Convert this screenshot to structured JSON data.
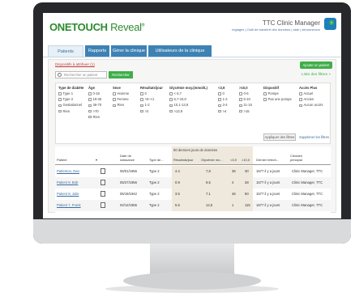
{
  "app": {
    "logo_main": "ONETOUCH",
    "logo_sub": "Reveal",
    "logo_mark": "®",
    "title": "TTC Clinic Manager",
    "header_links": "réglages | Outil de transfert des données | aide | déconnexion",
    "notification_count": "1"
  },
  "tabs": [
    {
      "label": "Patients",
      "active": true
    },
    {
      "label": "Rapports",
      "active": false
    },
    {
      "label": "Gérer la clinique",
      "active": false
    },
    {
      "label": "Utilisateurs de la clinique",
      "active": false
    }
  ],
  "toolbar": {
    "alert": "Dispositifs à attribuer (1)",
    "add_patient": "Ajouter un patient",
    "search_placeholder": "Rechercher un patient",
    "search_button": "Rechercher",
    "filters_link": "Liste des filtres »"
  },
  "filters": {
    "type": {
      "header": "Type de diabète",
      "options": [
        "Type 1",
        "Type 2",
        "Gestationnel",
        "Rien"
      ]
    },
    "age": {
      "header": "Âge",
      "options": [
        "0-18",
        "19-35",
        "36-70",
        ">70",
        "Rien"
      ]
    },
    "sex": {
      "header": "Sexe",
      "options": [
        "Homme",
        "Femme",
        "Rien"
      ]
    },
    "results": {
      "header": "Résultats/jour",
      "options": [
        "0",
        ">0–<1",
        "1-2",
        ">2"
      ]
    },
    "glycemia": {
      "header": "Glycémie moy.(mmol/L)",
      "options": [
        "< 6,7",
        "6,7-10,0",
        "10,1-13,9",
        ">13,9"
      ]
    },
    "lt39": {
      "header": "<3,9",
      "options": [
        "0",
        "1-2",
        "3-4",
        ">4"
      ]
    },
    "gt100": {
      "header": ">10,0",
      "options": [
        "0-5",
        "6-10",
        "11-15",
        ">15"
      ]
    },
    "device": {
      "header": "Dispositif",
      "options": [
        "Pompe",
        "Pas une pompe"
      ]
    },
    "access": {
      "header": "Accès Plus",
      "options": [
        "Actuel",
        "Ancien",
        "Aucun accès"
      ]
    },
    "apply": "Appliquer des filtres",
    "clear": "Supprimer les filtres"
  },
  "table": {
    "band_title": "90 derniers jours de données",
    "headers": {
      "patient": "Patient",
      "birth": "Date de\nnaissance",
      "type": "Type de...",
      "results": "Résultats/jour",
      "glycemia": "Glycémie mo...",
      "lt39": "<3,9",
      "gt100": ">10,0",
      "last_sync": "Dernier télech...",
      "clinician": "Clinicien\nprincipal"
    },
    "rows": [
      {
        "patient": "Patterson, Dan",
        "birth": "05/01/1956",
        "type": "Type 2",
        "results": "4.4",
        "glycemia": "7,8",
        "lt39": "36",
        "gt100": "30",
        "last_sync": "1577 il y a jours",
        "clinician": "Clinic Manager, TTC"
      },
      {
        "patient": "Patient 9, Bob",
        "birth": "05/27/1956",
        "type": "Type 2",
        "results": "0.9",
        "glycemia": "9,5",
        "lt39": "4",
        "gt100": "28",
        "last_sync": "1577 il y a jours",
        "clinician": "Clinic Manager, TTC"
      },
      {
        "patient": "Patient 8, Julie",
        "birth": "05/19/1942",
        "type": "Type 2",
        "results": "3.5",
        "glycemia": "7,1",
        "lt39": "46",
        "gt100": "50",
        "last_sync": "1577 il y a jours",
        "clinician": "Clinic Manager, TTC"
      },
      {
        "patient": "Patient 7, Frank",
        "birth": "02/12/1965",
        "type": "Type 2",
        "results": "5.6",
        "glycemia": "12,5",
        "lt39": "1",
        "gt100": "115",
        "last_sync": "1577 il y a jours",
        "clinician": "Clinic Manager, TTC"
      }
    ]
  },
  "colors": {
    "brand_green": "#3fae49",
    "tab_blue": "#3e82b4",
    "band_beige": "#efe8dc"
  }
}
